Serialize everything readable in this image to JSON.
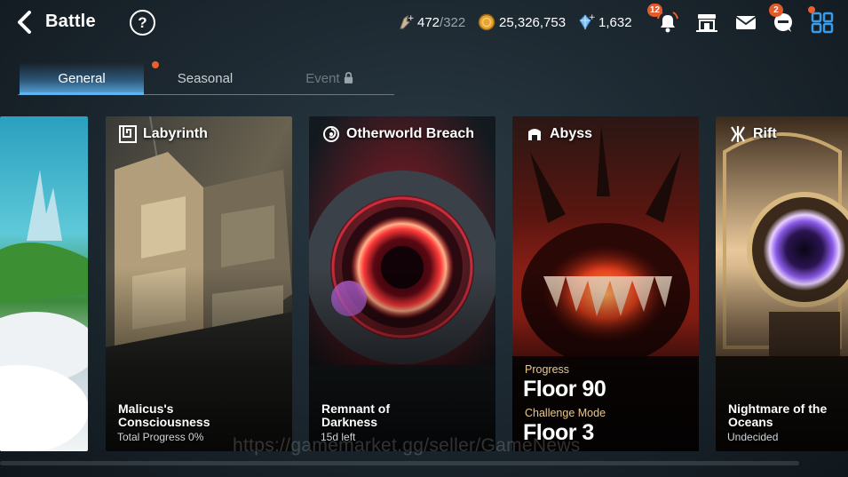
{
  "header": {
    "back_icon": "chevron-left-icon",
    "title": "Battle",
    "help_label": "?"
  },
  "resources": {
    "stamina": {
      "icon": "stamina-icon",
      "value": "472",
      "max": "/322"
    },
    "gold": {
      "icon": "gold-coin-icon",
      "value": "25,326,753"
    },
    "skystone": {
      "icon": "skystone-crystal-icon",
      "value": "1,632"
    }
  },
  "top_icons": {
    "notifications": {
      "icon": "bell-icon",
      "badge": "12"
    },
    "shop": {
      "icon": "shop-icon"
    },
    "mail": {
      "icon": "mail-icon"
    },
    "chat": {
      "icon": "chat-icon",
      "badge": "2"
    },
    "menu": {
      "icon": "grid-menu-icon"
    }
  },
  "tabs": [
    {
      "label": "General",
      "state": "active"
    },
    {
      "label": "Seasonal",
      "state": "normal",
      "has_dot": true
    },
    {
      "label": "Event",
      "state": "locked"
    }
  ],
  "cards": [
    {
      "title": "",
      "name": "",
      "sub": ""
    },
    {
      "title": "Labyrinth",
      "icon": "maze-icon",
      "name_line1": "Malicus's",
      "name_line2": "Consciousness",
      "sub": "Total Progress 0%"
    },
    {
      "title": "Otherworld Breach",
      "icon": "portal-swirl-icon",
      "name_line1": "Remnant of",
      "name_line2": "Darkness",
      "sub": "15d left"
    },
    {
      "title": "Abyss",
      "icon": "abyss-tower-icon",
      "progress_label": "Progress",
      "progress_value": "Floor 90",
      "challenge_label": "Challenge Mode",
      "challenge_value": "Floor 3"
    },
    {
      "title": "Rift",
      "icon": "rift-icon",
      "name_line1": "Nightmare of the",
      "name_line2": "Oceans",
      "sub": "Undecided"
    }
  ],
  "watermark": "https://gamemarket.gg/seller/GameNews",
  "colors": {
    "accent_blue": "#5fb4ee",
    "badge_orange": "#e25b2c",
    "challenge_gold": "#e9c98a"
  }
}
